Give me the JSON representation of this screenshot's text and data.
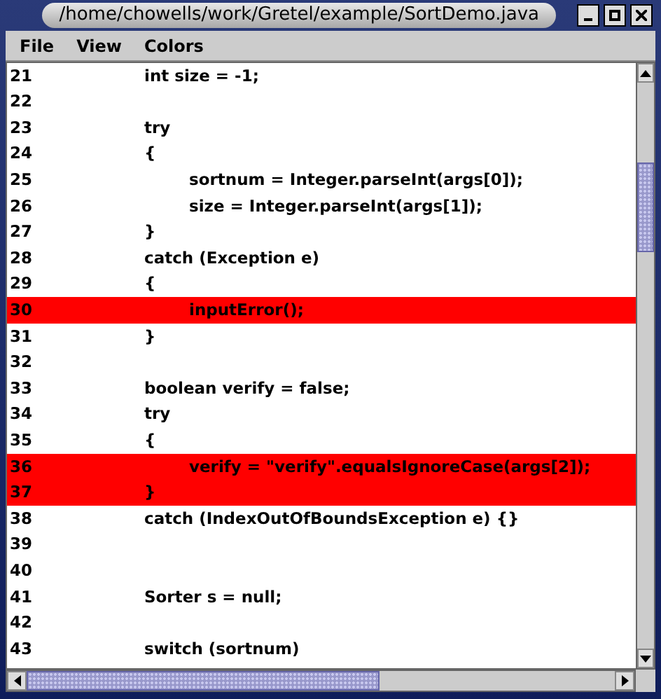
{
  "window": {
    "title": "/home/chowells/work/Gretel/example/SortDemo.java"
  },
  "menu": [
    "File",
    "View",
    "Colors"
  ],
  "lines": [
    {
      "number": "21",
      "code": "int size = -1;",
      "kind": "outer",
      "highlighted": false
    },
    {
      "number": "22",
      "highlighted": false
    },
    {
      "number": "23",
      "code": "try",
      "kind": "outer",
      "highlighted": false
    },
    {
      "number": "24",
      "code": "{",
      "kind": "outer",
      "highlighted": false
    },
    {
      "number": "25",
      "code": "sortnum = Integer.parseInt(args[0]);",
      "kind": "inner",
      "highlighted": false
    },
    {
      "number": "26",
      "code": "size = Integer.parseInt(args[1]);",
      "kind": "inner",
      "highlighted": false
    },
    {
      "number": "27",
      "code": "}",
      "kind": "outer",
      "highlighted": false
    },
    {
      "number": "28",
      "code": "catch (Exception e)",
      "kind": "outer",
      "highlighted": false
    },
    {
      "number": "29",
      "code": "{",
      "kind": "outer",
      "highlighted": false
    },
    {
      "number": "30",
      "code": "inputError();",
      "kind": "inner",
      "highlighted": true
    },
    {
      "number": "31",
      "code": "}",
      "kind": "outer",
      "highlighted": false
    },
    {
      "number": "32",
      "highlighted": false
    },
    {
      "number": "33",
      "code": "boolean verify = false;",
      "kind": "outer",
      "highlighted": false
    },
    {
      "number": "34",
      "code": "try",
      "kind": "outer",
      "highlighted": false
    },
    {
      "number": "35",
      "code": "{",
      "kind": "outer",
      "highlighted": false
    },
    {
      "number": "36",
      "code": "verify = \"verify\".equalsIgnoreCase(args[2]);",
      "kind": "inner",
      "highlighted": true
    },
    {
      "number": "37",
      "code": "}",
      "kind": "outer",
      "highlighted": true
    },
    {
      "number": "38",
      "code": "catch (IndexOutOfBoundsException e) {}",
      "kind": "outer",
      "highlighted": false
    },
    {
      "number": "39",
      "highlighted": false
    },
    {
      "number": "40",
      "highlighted": false
    },
    {
      "number": "41",
      "code": "Sorter s = null;",
      "kind": "outer",
      "highlighted": false
    },
    {
      "number": "42",
      "highlighted": false
    },
    {
      "number": "43",
      "code": "switch (sortnum)",
      "kind": "outer",
      "highlighted": false
    }
  ]
}
